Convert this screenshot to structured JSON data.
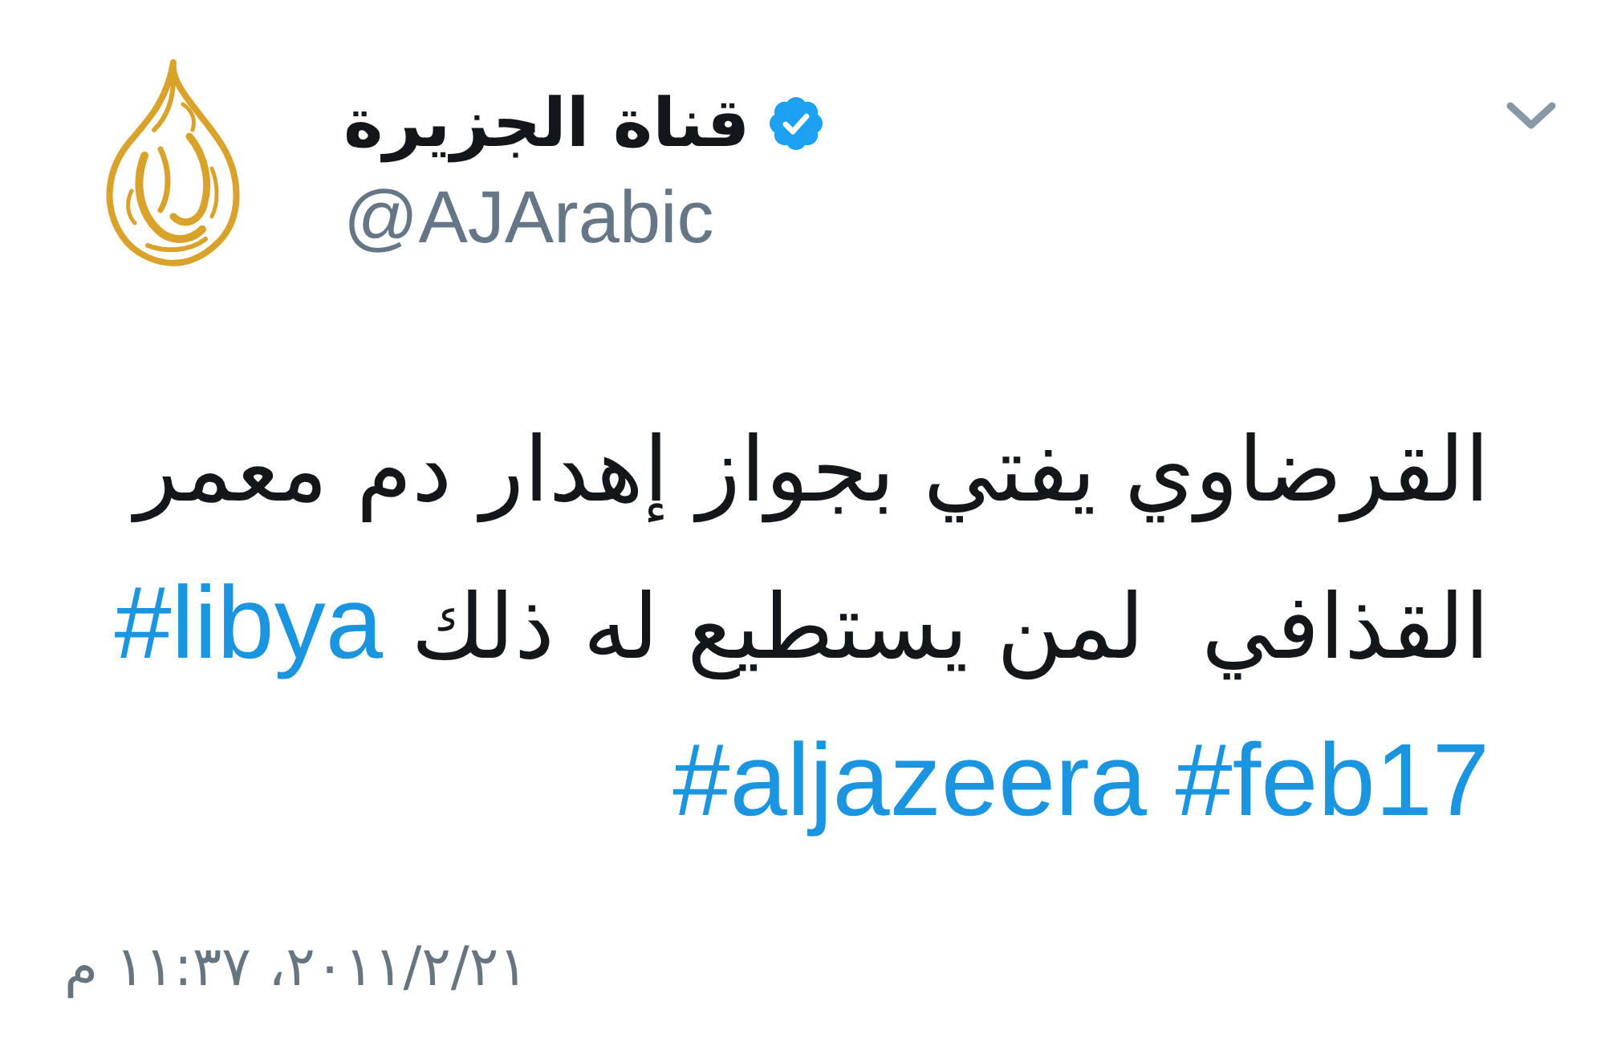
{
  "tweet": {
    "author": {
      "name": "قناة الجزيرة",
      "handle": "@AJArabic",
      "verified": true
    },
    "text": "القرضاوي يفتي بجواز إهدار دم معمر القذافي  لمن يستطيع له ذلك",
    "hashtags": [
      "#libya",
      "#aljazeera",
      "#feb17"
    ],
    "timestamp": "٢٠١١/٢/٢١، ١١:٣٧ م"
  }
}
